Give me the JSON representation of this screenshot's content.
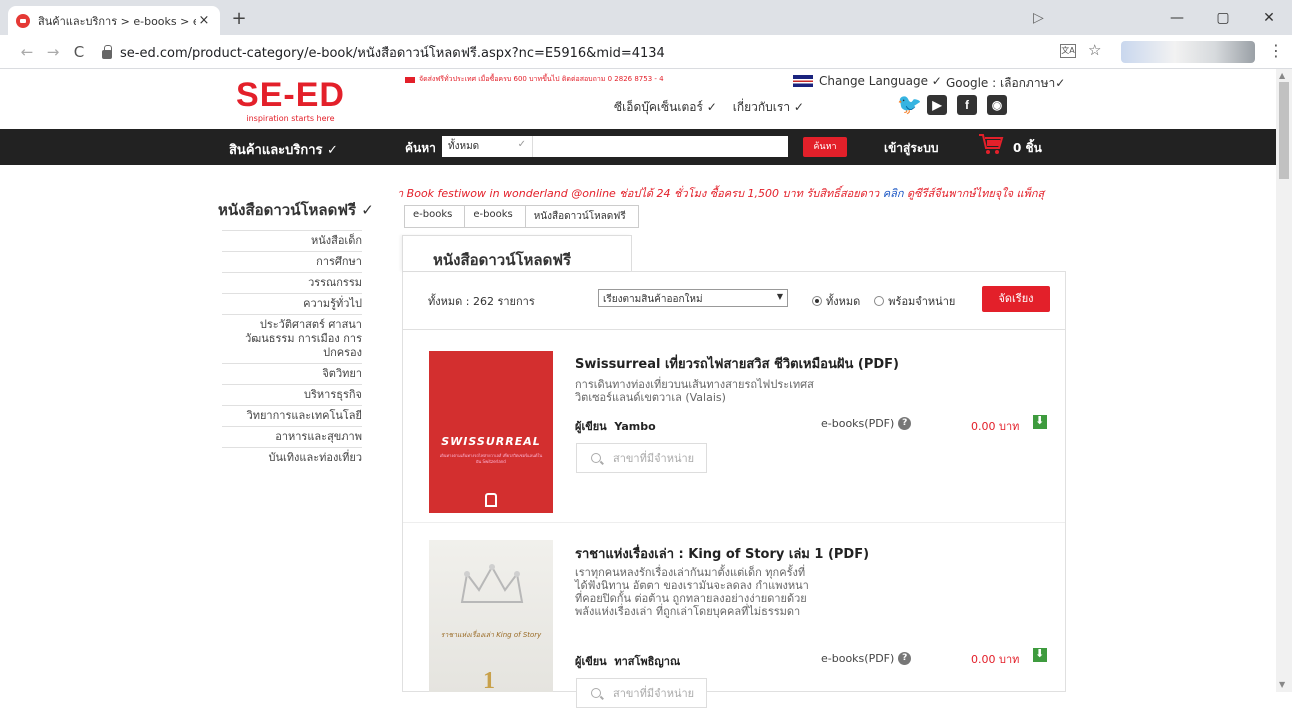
{
  "browser": {
    "tab_title": "สินค้าและบริการ > e-books > e-boo",
    "tab_close": "×",
    "new_tab": "+",
    "url": "se-ed.com/product-category/e-book/หนังสือดาวน์โหลดฟรี.aspx?nc=E5916&mid=4134",
    "back": "←",
    "forward": "→",
    "reload": "C",
    "minimize": "—",
    "restore": "▢",
    "close": "✕",
    "star": "☆",
    "menu": "⋮",
    "translate": "文A",
    "pointer": "▷"
  },
  "header": {
    "logo": "SE-ED",
    "tagline": "inspiration starts here",
    "top_info": "จัดส่งฟรีทั่วประเทศ เมื่อซื้อครบ 600 บาทขึ้นไป  ติดต่อสอบถาม 0 2826 8753 - 4",
    "change_language": "Change Language ✓",
    "google_language": "Google : เลือกภาษา✓",
    "submenu": [
      "ซีเอ็ดบุ๊คเซ็นเตอร์ ✓",
      "เกี่ยวกับเรา ✓"
    ],
    "social": [
      "twitter-icon",
      "youtube-icon",
      "facebook-icon",
      "line-icon"
    ]
  },
  "nav": {
    "products": "สินค้าและบริการ  ✓",
    "search_label": "ค้นหา",
    "search_scope": "ทั้งหมด",
    "search_scope_arrow": "✓",
    "search_placeholder": "",
    "search_button": "ค้นหา",
    "login": "เข้าสู่ระบบ",
    "cart_count": "0  ชิ้น"
  },
  "sidebar": {
    "title": "หนังสือดาวน์โหลดฟรี ✓",
    "items": [
      "หนังสือเด็ก",
      "การศึกษา",
      "วรรณกรรม",
      "ความรู้ทั่วไป",
      "ประวัติศาสตร์ ศาสนา วัฒนธรรม การเมือง การปกครอง",
      "จิตวิทยา",
      "บริหารธุรกิจ",
      "วิทยาการและเทคโนโลยี",
      "อาหารและสุขภาพ",
      "บันเทิงและท่องเที่ยว"
    ]
  },
  "promo": {
    "text": "า Book festiwow in wonderland @online ช่อปได้ 24 ชั่วโมง ซื้อครบ 1,500 บาท รับสิทธิ์สอยดาว ",
    "link1": "คลิก",
    "text2": " ดูซีรีส์จีนพากษ์ไทยจุใจ แพ็กสุ"
  },
  "breadcrumb": [
    "e-books",
    "e-books",
    "หนังสือดาวน์โหลดฟรี"
  ],
  "page_title": "หนังสือดาวน์โหลดฟรี",
  "filter": {
    "total": "ทั้งหมด : 262 รายการ",
    "sort_value": "เรียงตามสินค้าออกใหม่",
    "sort_arrow": "▼",
    "radio_all": "ทั้งหมด",
    "radio_available": "พร้อมจำหน่าย",
    "sort_button": "จัดเรียง"
  },
  "products": [
    {
      "title": "Swissurreal เที่ยวรถไฟสายสวิส ชีวิตเหมือนฝัน (PDF)",
      "desc": "การเดินทางท่องเที่ยวบนเส้นทางสายรถไฟประเทศสวิตเซอร์แลนด์เขตวาเล (Valais)",
      "author_label": "ผู้เขียน",
      "author": "Yambo",
      "type": "e-books(PDF)",
      "price": "0.00 บาท",
      "branch": "สาขาที่มีจำหน่าย",
      "cover_title": "SWISSURREAL",
      "cover_sub": "เดินทางตามเส้นทางรถไฟสายวาเลส์ เที่ยวสวิตเซอร์แลนด์ในฝัน Switzerland"
    },
    {
      "title": "ราชาแห่งเรื่องเล่า : King of Story เล่ม 1 (PDF)",
      "desc": "เราทุกคนหลงรักเรื่องเล่ากันมาตั้งแต่เด็ก ทุกครั้งที่ได้ฟังนิทาน อัตตา ของเรามันจะลดลง กำแพงหนาที่คอยปิดกั้น ต่อต้าน ถูกทลายลงอย่างง่ายดายด้วยพลังแห่งเรื่องเล่า ที่ถูกเล่าโดยบุคคลที่ไม่ธรรมดา",
      "author_label": "ผู้เขียน",
      "author": "ทาสโพธิญาณ",
      "type": "e-books(PDF)",
      "price": "0.00 บาท",
      "branch": "สาขาที่มีจำหน่าย",
      "cover_title": "ราชาแห่งเรื่องเล่า King of Story",
      "cover_num": "1"
    }
  ],
  "colors": {
    "brand": "#e3202a",
    "nav_bg": "#222222",
    "download": "#3e9b3e"
  }
}
